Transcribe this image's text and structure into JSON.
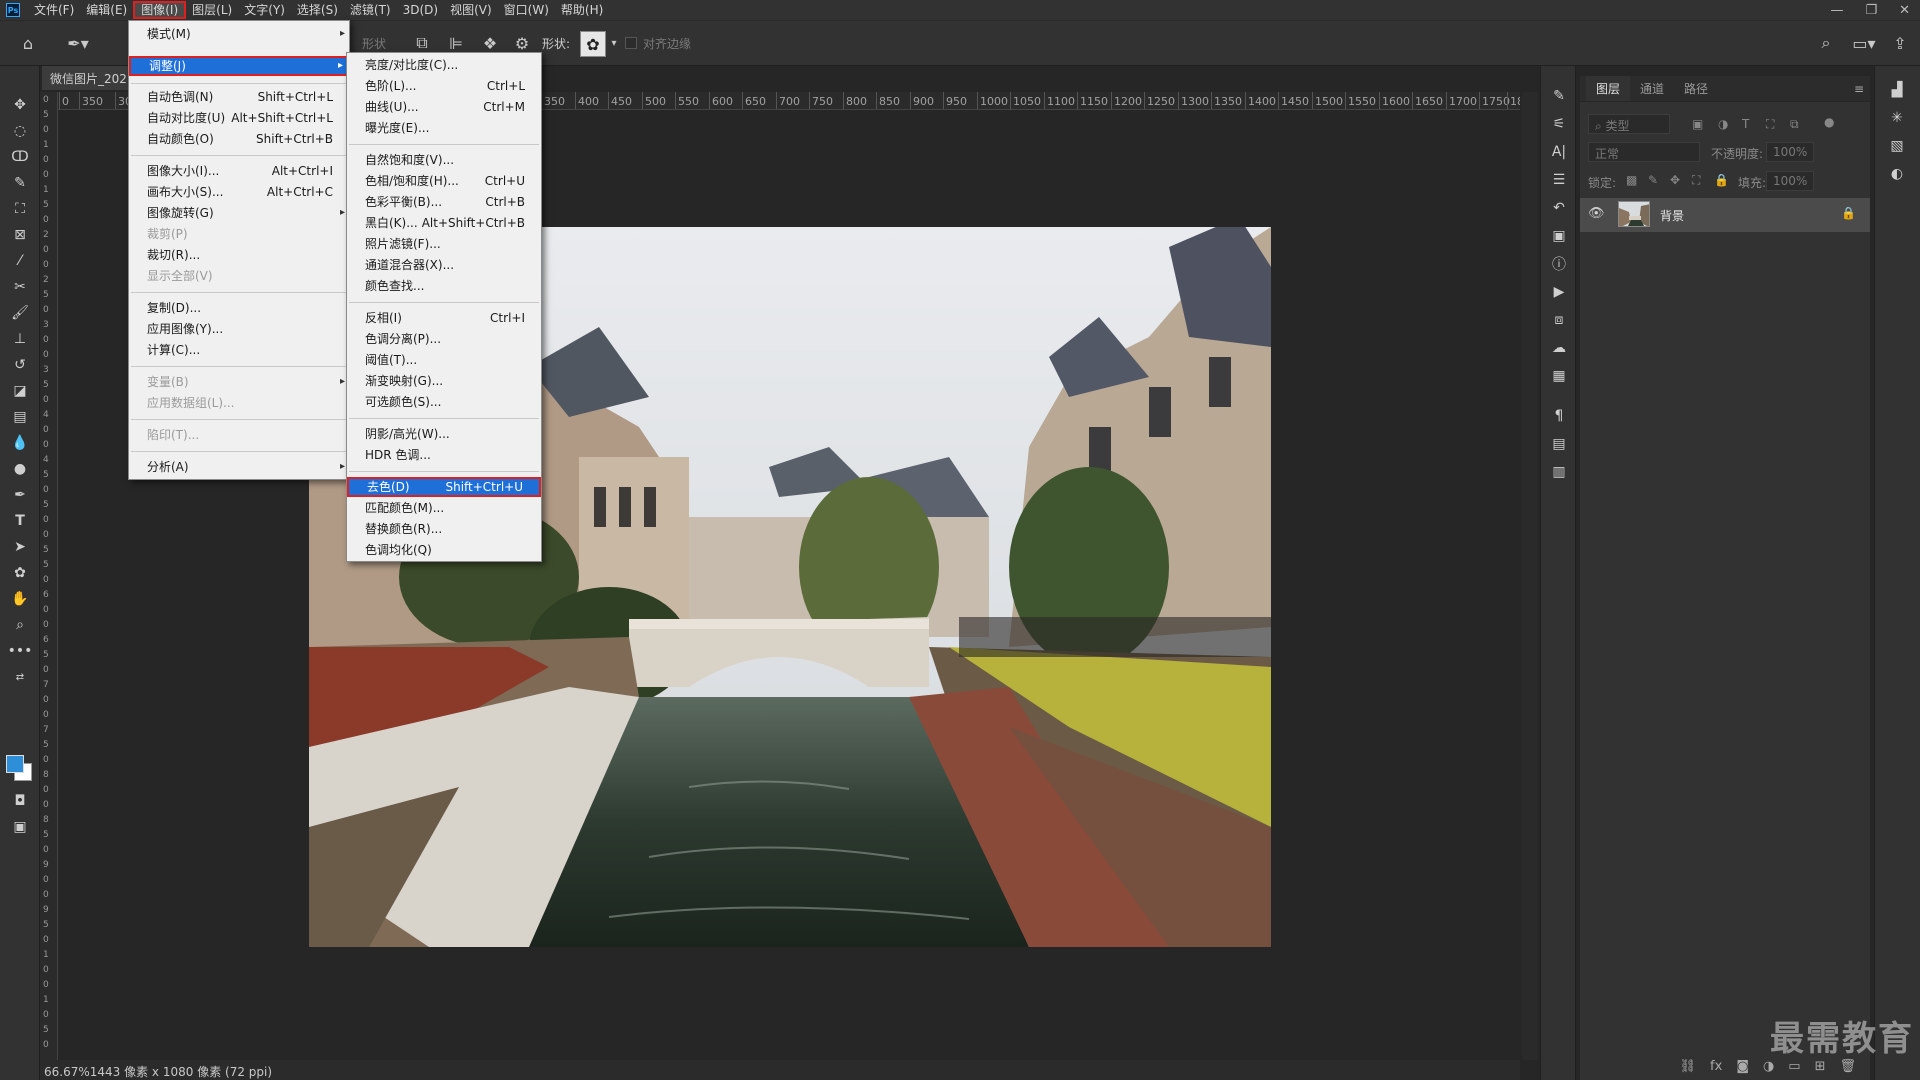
{
  "menubar": {
    "items": [
      "文件(F)",
      "编辑(E)",
      "图像(I)",
      "图层(L)",
      "文字(Y)",
      "选择(S)",
      "滤镜(T)",
      "3D(D)",
      "视图(V)",
      "窗口(W)",
      "帮助(H)"
    ],
    "active": "图像(I)",
    "logo": "Ps"
  },
  "window_controls": {
    "minimize": "—",
    "restore": "❐",
    "close": "✕"
  },
  "options": {
    "mode_label": "形状",
    "shape_label": "形状:",
    "align_edges": "对齐边缘"
  },
  "doc_tab": {
    "title": "微信图片_202"
  },
  "ruler": {
    "top_ticks": [
      "0",
      "350",
      "30",
      "350",
      "400",
      "450",
      "500",
      "550",
      "600",
      "650",
      "700",
      "750",
      "800",
      "850",
      "900",
      "950",
      "1000",
      "1050",
      "1100",
      "1150",
      "1200",
      "1250",
      "1300",
      "1350",
      "1400",
      "1450",
      "1500",
      "1550",
      "1600",
      "1650",
      "1700",
      "1750",
      "18"
    ],
    "left_ticks": [
      "0",
      "5",
      "0",
      "1",
      "0",
      "0",
      "1",
      "5",
      "0",
      "2",
      "0",
      "0",
      "2",
      "5",
      "0",
      "3",
      "0",
      "0",
      "3",
      "5",
      "0",
      "4",
      "0",
      "0",
      "4",
      "5",
      "0",
      "5",
      "0",
      "0",
      "5",
      "5",
      "0",
      "6",
      "0",
      "0",
      "6",
      "5",
      "0",
      "7",
      "0",
      "0",
      "7",
      "5",
      "0",
      "8",
      "0",
      "0",
      "8",
      "5",
      "0",
      "9",
      "0",
      "0",
      "9",
      "5",
      "0",
      "1",
      "0",
      "0",
      "1",
      "0",
      "5",
      "0"
    ]
  },
  "image_menu": {
    "items": [
      {
        "label": "模式(M)",
        "shortcut": "",
        "sub": true,
        "disabled": false
      },
      {
        "label": "调整(J)",
        "shortcut": "",
        "sub": true,
        "disabled": false,
        "highlight": true
      },
      {
        "label": "自动色调(N)",
        "shortcut": "Shift+Ctrl+L",
        "sub": false,
        "disabled": false
      },
      {
        "label": "自动对比度(U)",
        "shortcut": "Alt+Shift+Ctrl+L",
        "sub": false,
        "disabled": false
      },
      {
        "label": "自动颜色(O)",
        "shortcut": "Shift+Ctrl+B",
        "sub": false,
        "disabled": false
      },
      {
        "label": "图像大小(I)...",
        "shortcut": "Alt+Ctrl+I",
        "sub": false,
        "disabled": false
      },
      {
        "label": "画布大小(S)...",
        "shortcut": "Alt+Ctrl+C",
        "sub": false,
        "disabled": false
      },
      {
        "label": "图像旋转(G)",
        "shortcut": "",
        "sub": true,
        "disabled": false
      },
      {
        "label": "裁剪(P)",
        "shortcut": "",
        "sub": false,
        "disabled": true
      },
      {
        "label": "裁切(R)...",
        "shortcut": "",
        "sub": false,
        "disabled": false
      },
      {
        "label": "显示全部(V)",
        "shortcut": "",
        "sub": false,
        "disabled": true
      },
      {
        "label": "复制(D)...",
        "shortcut": "",
        "sub": false,
        "disabled": false
      },
      {
        "label": "应用图像(Y)...",
        "shortcut": "",
        "sub": false,
        "disabled": false
      },
      {
        "label": "计算(C)...",
        "shortcut": "",
        "sub": false,
        "disabled": false
      },
      {
        "label": "变量(B)",
        "shortcut": "",
        "sub": true,
        "disabled": true
      },
      {
        "label": "应用数据组(L)...",
        "shortcut": "",
        "sub": false,
        "disabled": true
      },
      {
        "label": "陷印(T)...",
        "shortcut": "",
        "sub": false,
        "disabled": true
      },
      {
        "label": "分析(A)",
        "shortcut": "",
        "sub": true,
        "disabled": false
      }
    ]
  },
  "adjust_menu": {
    "items": [
      {
        "label": "亮度/对比度(C)...",
        "shortcut": ""
      },
      {
        "label": "色阶(L)...",
        "shortcut": "Ctrl+L"
      },
      {
        "label": "曲线(U)...",
        "shortcut": "Ctrl+M"
      },
      {
        "label": "曝光度(E)...",
        "shortcut": ""
      },
      {
        "label": "自然饱和度(V)...",
        "shortcut": ""
      },
      {
        "label": "色相/饱和度(H)...",
        "shortcut": "Ctrl+U"
      },
      {
        "label": "色彩平衡(B)...",
        "shortcut": "Ctrl+B"
      },
      {
        "label": "黑白(K)...",
        "shortcut": "Alt+Shift+Ctrl+B"
      },
      {
        "label": "照片滤镜(F)...",
        "shortcut": ""
      },
      {
        "label": "通道混合器(X)...",
        "shortcut": ""
      },
      {
        "label": "颜色查找...",
        "shortcut": ""
      },
      {
        "label": "反相(I)",
        "shortcut": "Ctrl+I"
      },
      {
        "label": "色调分离(P)...",
        "shortcut": ""
      },
      {
        "label": "阈值(T)...",
        "shortcut": ""
      },
      {
        "label": "渐变映射(G)...",
        "shortcut": ""
      },
      {
        "label": "可选颜色(S)...",
        "shortcut": ""
      },
      {
        "label": "阴影/高光(W)...",
        "shortcut": ""
      },
      {
        "label": "HDR 色调...",
        "shortcut": ""
      },
      {
        "label": "去色(D)",
        "shortcut": "Shift+Ctrl+U",
        "highlight": true
      },
      {
        "label": "匹配颜色(M)...",
        "shortcut": ""
      },
      {
        "label": "替换颜色(R)...",
        "shortcut": ""
      },
      {
        "label": "色调均化(Q)",
        "shortcut": ""
      }
    ]
  },
  "layers_panel": {
    "tabs": [
      "图层",
      "通道",
      "路径"
    ],
    "filter_placeholder": "类型",
    "blend_mode": "正常",
    "opacity_label": "不透明度:",
    "opacity_value": "100%",
    "lock_label": "锁定:",
    "fill_label": "填充:",
    "fill_value": "100%",
    "layer_name": "背景"
  },
  "status": {
    "text": "66.67%1443 像素 x 1080 像素 (72 ppi)"
  },
  "watermark": {
    "text": "最需教育"
  },
  "colors": {
    "accent": "#1e6fd8",
    "highlight_border": "#e02020",
    "foreground": "#2e8ed8",
    "background": "#ffffff"
  }
}
